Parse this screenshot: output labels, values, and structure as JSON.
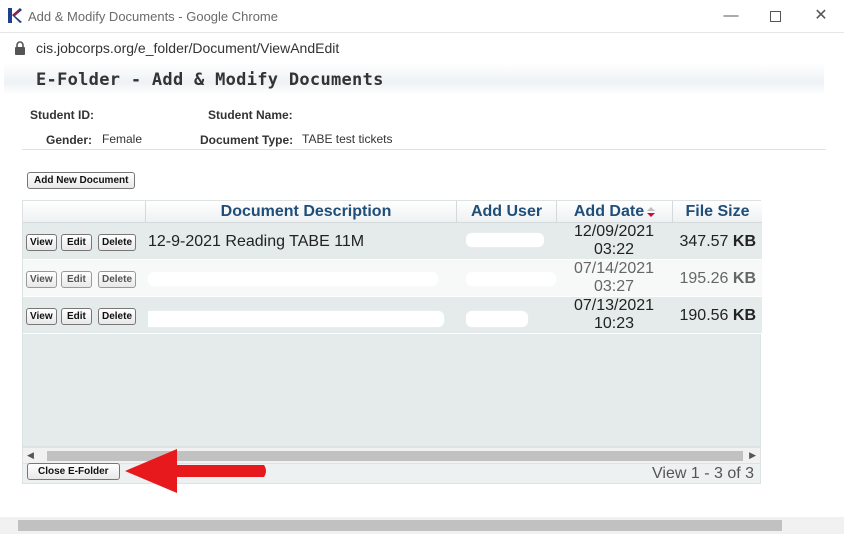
{
  "window": {
    "title": "Add & Modify Documents - Google Chrome",
    "url": "cis.jobcorps.org/e_folder/Document/ViewAndEdit",
    "icons": {
      "app": "jobcorps-logo-icon",
      "lock": "lock-icon",
      "minimize": "minimize-icon",
      "maximize": "maximize-icon",
      "close": "close-icon"
    }
  },
  "page": {
    "title": "E-Folder - Add & Modify Documents",
    "student_id_label": "Student ID:",
    "student_name_label": "Student Name:",
    "gender_label": "Gender:",
    "gender_value": "Female",
    "document_type_label": "Document Type:",
    "document_type_value": "TABE test tickets",
    "add_button": "Add New Document",
    "close_button": "Close E-Folder"
  },
  "grid": {
    "columns": [
      "Document Description",
      "Add User",
      "Add Date",
      "File Size"
    ],
    "sort_column": "Add Date",
    "actions": {
      "view": "View",
      "edit": "Edit",
      "delete": "Delete"
    },
    "rows": [
      {
        "description": "12-9-2021 Reading TABE 11M",
        "user": "",
        "date": "12/09/2021",
        "time": "03:22",
        "size": "347.57",
        "unit": "KB"
      },
      {
        "description": "",
        "user": "",
        "date": "07/14/2021",
        "time": "03:27",
        "size": "195.26",
        "unit": "KB"
      },
      {
        "description": "",
        "user": "",
        "date": "07/13/2021",
        "time": "10:23",
        "size": "190.56",
        "unit": "KB"
      }
    ],
    "pager": "View 1 - 3 of 3"
  },
  "colors": {
    "header_text": "#1f4e79",
    "arrow": "#e8191c",
    "row_odd": "#e4ebea",
    "row_even": "#f7f9f9"
  }
}
